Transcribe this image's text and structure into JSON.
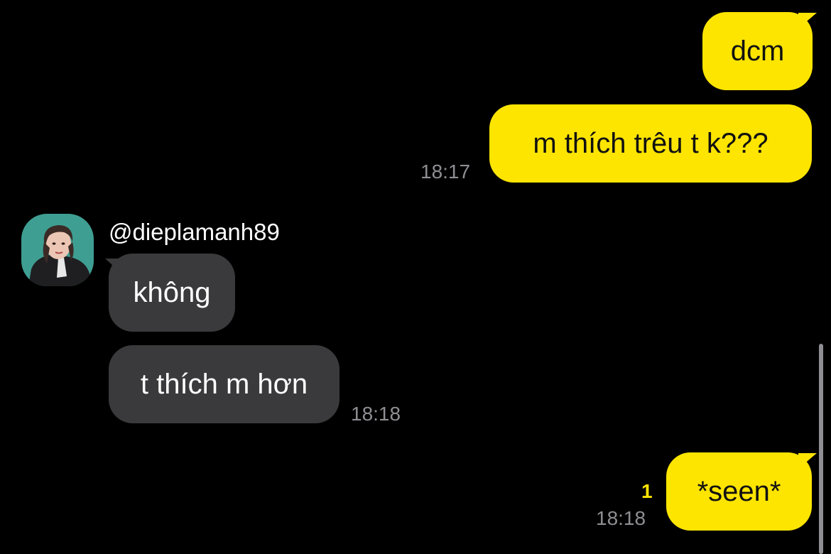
{
  "chat": {
    "contact": {
      "username": "@dieplamanh89"
    },
    "messages": [
      {
        "direction": "out",
        "text": "dcm"
      },
      {
        "direction": "out",
        "text": "m thích trêu t k???",
        "time": "18:17"
      },
      {
        "direction": "in",
        "text": "không"
      },
      {
        "direction": "in",
        "text": "t thích m hơn",
        "time": "18:18"
      },
      {
        "direction": "out",
        "text": "*seen*",
        "time": "18:18",
        "unread_count": "1"
      }
    ]
  },
  "colors": {
    "background": "#000000",
    "outgoing_bubble": "#fee500",
    "incoming_bubble": "#3a3a3c",
    "timestamp": "#8e8e93",
    "unread_badge": "#fee500"
  }
}
